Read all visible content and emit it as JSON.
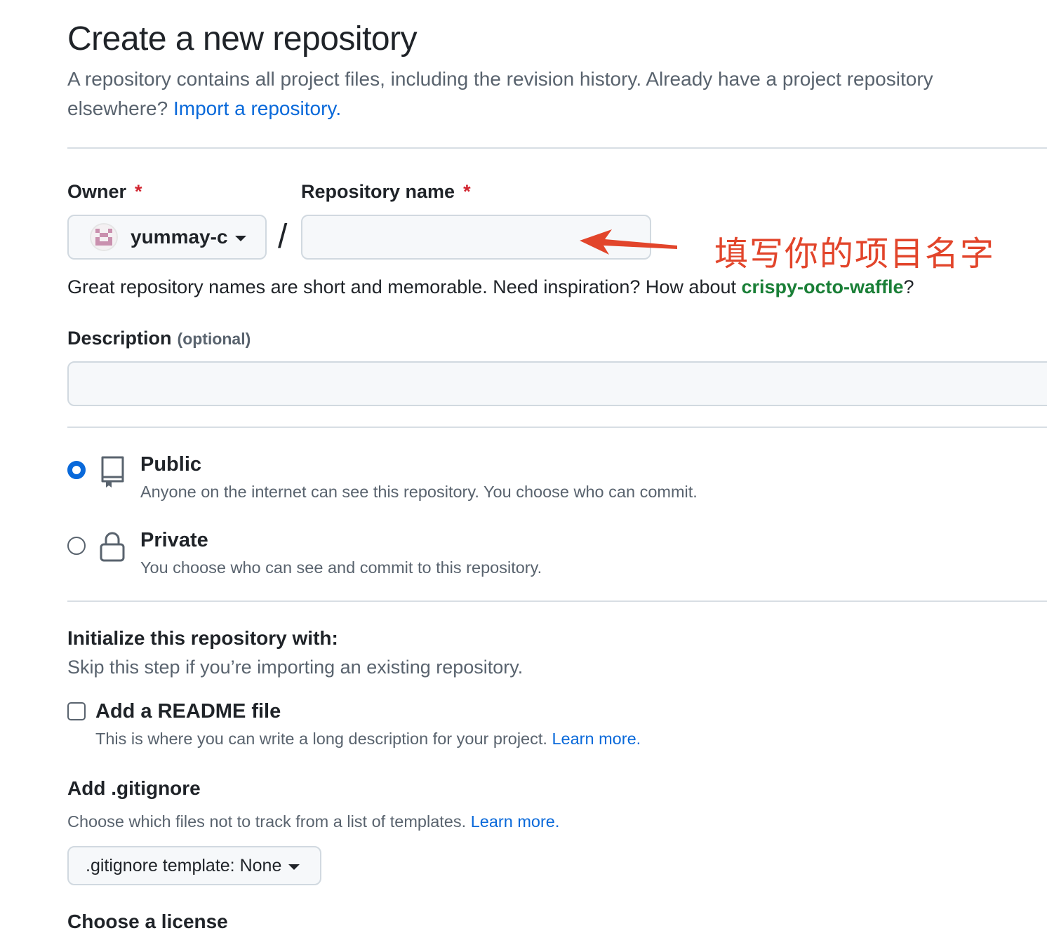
{
  "header": {
    "title": "Create a new repository",
    "subtitle": "A repository contains all project files, including the revision history. Already have a project repository elsewhere?",
    "import_link": "Import a repository."
  },
  "owner": {
    "label": "Owner",
    "required_mark": "*",
    "selected": "yummay-c"
  },
  "separator": "/",
  "repo_name": {
    "label": "Repository name",
    "required_mark": "*",
    "value": ""
  },
  "annotation": {
    "text": "填写你的项目名字",
    "color": "#e2452b"
  },
  "name_hint": {
    "text": "Great repository names are short and memorable. Need inspiration? How about ",
    "suggestion": "crispy-octo-waffle",
    "suffix": "?"
  },
  "description": {
    "label": "Description",
    "optional": "(optional)",
    "value": ""
  },
  "visibility": {
    "public": {
      "title": "Public",
      "desc": "Anyone on the internet can see this repository. You choose who can commit.",
      "checked": true,
      "icon": "repo-icon"
    },
    "private": {
      "title": "Private",
      "desc": "You choose who can see and commit to this repository.",
      "checked": false,
      "icon": "lock-icon"
    }
  },
  "initialize": {
    "title": "Initialize this repository with:",
    "desc": "Skip this step if you’re importing an existing repository.",
    "readme": {
      "label": "Add a README file",
      "desc": "This is where you can write a long description for your project.",
      "link": "Learn more.",
      "checked": false
    }
  },
  "gitignore": {
    "title": "Add .gitignore",
    "desc": "Choose which files not to track from a list of templates.",
    "link": "Learn more.",
    "select_prefix": ".gitignore template:",
    "select_value": "None"
  },
  "license": {
    "title": "Choose a license"
  },
  "colors": {
    "link": "#0969da",
    "success": "#1a7f37",
    "required": "#d1242f",
    "radio_selected": "#0969da"
  }
}
